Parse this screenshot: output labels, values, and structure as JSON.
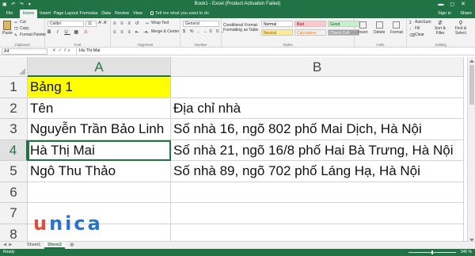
{
  "window": {
    "title": "Book1 - Excel (Product Activation Failed)",
    "signin": "Sign in",
    "share": "Share"
  },
  "ribbon_tabs": [
    "File",
    "Home",
    "Insert",
    "Page Layout",
    "Formulas",
    "Data",
    "Review",
    "View"
  ],
  "active_tab": "Home",
  "tell_me": "Tell me what you want to do",
  "ribbon": {
    "clipboard": {
      "paste": "Paste",
      "cut": "Cut",
      "copy": "Copy",
      "format_painter": "Format Painter",
      "label": "Clipboard"
    },
    "font": {
      "name": "Calibri",
      "size": "11",
      "label": "Font"
    },
    "alignment": {
      "wrap_text": "Wrap Text",
      "merge_center": "Merge & Center",
      "label": "Alignment"
    },
    "number": {
      "format": "General",
      "label": "Number"
    },
    "styles": {
      "conditional": "Conditional Formatting",
      "format_table": "Format as Table",
      "cells": [
        {
          "name": "Normal",
          "bg": "#ffffff",
          "fg": "#000000"
        },
        {
          "name": "Bad",
          "bg": "#ffc7ce",
          "fg": "#9c0006"
        },
        {
          "name": "Good",
          "bg": "#c6efce",
          "fg": "#006100"
        },
        {
          "name": "Neutral",
          "bg": "#ffeb9c",
          "fg": "#9c5700"
        },
        {
          "name": "Calculation",
          "bg": "#f2f2f2",
          "fg": "#fa7d00"
        },
        {
          "name": "Check Cell",
          "bg": "#a5a5a5",
          "fg": "#ffffff"
        }
      ],
      "label": "Styles"
    },
    "cells": {
      "insert": "Insert",
      "delete": "Delete",
      "format": "Format",
      "label": "Cells"
    },
    "editing": {
      "autosum": "AutoSum",
      "fill": "Fill",
      "clear": "Clear",
      "sort_filter": "Sort & Filter",
      "find_select": "Find & Select",
      "label": "Editing"
    }
  },
  "formula_bar": {
    "name_box": "A4",
    "content": "Hà Thị Mai"
  },
  "columns": [
    "A",
    "B"
  ],
  "rows": [
    {
      "num": "1",
      "a": "Bảng 1",
      "b": ""
    },
    {
      "num": "2",
      "a": "Tên",
      "b": "Địa chỉ nhà"
    },
    {
      "num": "3",
      "a": "Nguyễn Trần Bảo Linh",
      "b": "Số nhà 16, ngõ 802 phố Mai Dịch, Hà Nội"
    },
    {
      "num": "4",
      "a": "Hà Thị Mai",
      "b": "Số nhà 21, ngõ 16/8 phố Hai Bà Trưng, Hà Nội"
    },
    {
      "num": "5",
      "a": "Ngô Thu Thảo",
      "b": "Số nhà 89, ngõ 702 phố Láng Hạ, Hà Nội"
    },
    {
      "num": "6",
      "a": "",
      "b": ""
    },
    {
      "num": "7",
      "a": "",
      "b": ""
    },
    {
      "num": "8",
      "a": "",
      "b": ""
    }
  ],
  "highlight_color": "#ffff00",
  "accent_color": "#217346",
  "logo": {
    "text": "unica"
  },
  "sheets": [
    "Sheet1",
    "Sheet2"
  ],
  "active_sheet": "Sheet2",
  "status": {
    "ready": "Ready",
    "zoom": "345 %"
  }
}
